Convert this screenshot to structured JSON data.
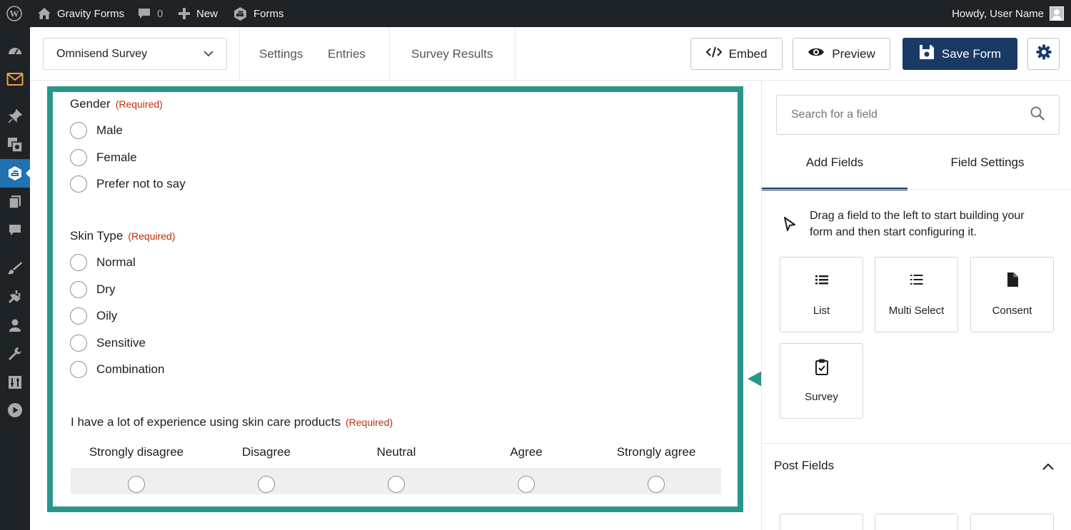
{
  "admin_bar": {
    "site_name": "Gravity Forms",
    "comments_count": "0",
    "new_label": "New",
    "forms_label": "Forms",
    "greeting": "Howdy, User Name"
  },
  "side_menu": [
    "dashboard-icon",
    "email-icon",
    "pin-icon",
    "media-icon",
    "gravity-forms-icon",
    "pages-icon",
    "comments-icon",
    "appearance-icon",
    "plugins-icon",
    "users-icon",
    "tools-icon",
    "settings-icon",
    "video-icon"
  ],
  "toolbar": {
    "form_name": "Omnisend Survey",
    "nav": [
      "Settings",
      "Entries",
      "Survey Results"
    ],
    "embed_label": "Embed",
    "preview_label": "Preview",
    "save_label": "Save Form"
  },
  "form": {
    "required_text": "(Required)",
    "gender": {
      "label": "Gender",
      "choices": [
        "Male",
        "Female",
        "Prefer not to say"
      ]
    },
    "skin_type": {
      "label": "Skin Type",
      "choices": [
        "Normal",
        "Dry",
        "Oily",
        "Sensitive",
        "Combination"
      ]
    },
    "likert": {
      "label": "I have a lot of experience using skin care products",
      "columns": [
        "Strongly disagree",
        "Disagree",
        "Neutral",
        "Agree",
        "Strongly agree"
      ]
    }
  },
  "sidebar": {
    "search_placeholder": "Search for a field",
    "tabs": [
      "Add Fields",
      "Field Settings"
    ],
    "hint": "Drag a field to the left to start building your form and then start configuring it.",
    "fields": [
      {
        "label": "List",
        "icon": "list-icon"
      },
      {
        "label": "Multi Select",
        "icon": "multi-select-icon"
      },
      {
        "label": "Consent",
        "icon": "consent-icon"
      },
      {
        "label": "Survey",
        "icon": "survey-icon"
      }
    ],
    "section_title": "Post Fields"
  },
  "colors": {
    "highlight": "#2a968b",
    "primary": "#1a3a66",
    "required": "#c02b0a",
    "admin_bg": "#1d2327"
  }
}
